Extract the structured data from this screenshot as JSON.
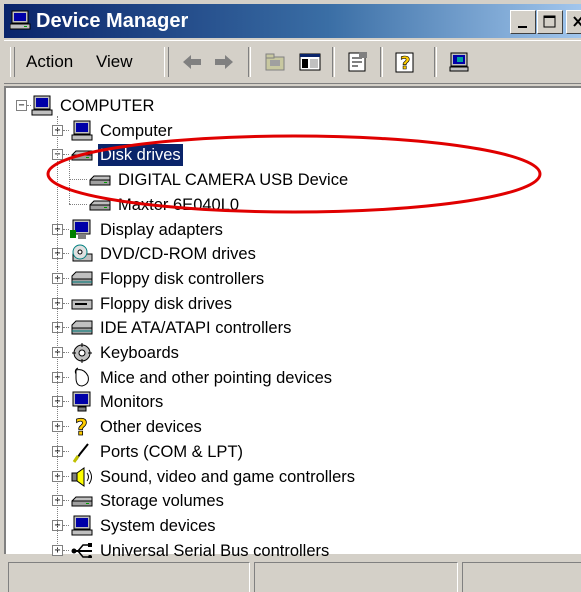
{
  "window": {
    "title": "Device Manager"
  },
  "menu": {
    "action": "Action",
    "view": "View"
  },
  "tree": {
    "root": "COMPUTER",
    "items": [
      {
        "label": "Computer",
        "icon": "computer-icon",
        "expanded": false
      },
      {
        "label": "Disk drives",
        "icon": "disk-drive-icon",
        "expanded": true,
        "selected": true,
        "children": [
          {
            "label": "DIGITAL CAMERA USB Device",
            "icon": "disk-drive-icon"
          },
          {
            "label": "Maxtor 6E040L0",
            "icon": "disk-drive-icon"
          }
        ]
      },
      {
        "label": "Display adapters",
        "icon": "display-adapter-icon",
        "expanded": false
      },
      {
        "label": "DVD/CD-ROM drives",
        "icon": "cdrom-icon",
        "expanded": false
      },
      {
        "label": "Floppy disk controllers",
        "icon": "controller-icon",
        "expanded": false
      },
      {
        "label": "Floppy disk drives",
        "icon": "floppy-drive-icon",
        "expanded": false
      },
      {
        "label": "IDE ATA/ATAPI controllers",
        "icon": "controller-icon",
        "expanded": false
      },
      {
        "label": "Keyboards",
        "icon": "keyboard-icon",
        "expanded": false
      },
      {
        "label": "Mice and other pointing devices",
        "icon": "mouse-icon",
        "expanded": false
      },
      {
        "label": "Monitors",
        "icon": "monitor-icon",
        "expanded": false
      },
      {
        "label": "Other devices",
        "icon": "question-icon",
        "expanded": false
      },
      {
        "label": "Ports (COM & LPT)",
        "icon": "port-icon",
        "expanded": false
      },
      {
        "label": "Sound, video and game controllers",
        "icon": "sound-icon",
        "expanded": false
      },
      {
        "label": "Storage volumes",
        "icon": "disk-drive-icon",
        "expanded": false
      },
      {
        "label": "System devices",
        "icon": "computer-icon",
        "expanded": false
      },
      {
        "label": "Universal Serial Bus controllers",
        "icon": "usb-icon",
        "expanded": false
      }
    ]
  },
  "colors": {
    "title_gradient_start": "#0a246a",
    "selection": "#0a246a",
    "annotation": "#e00000"
  }
}
